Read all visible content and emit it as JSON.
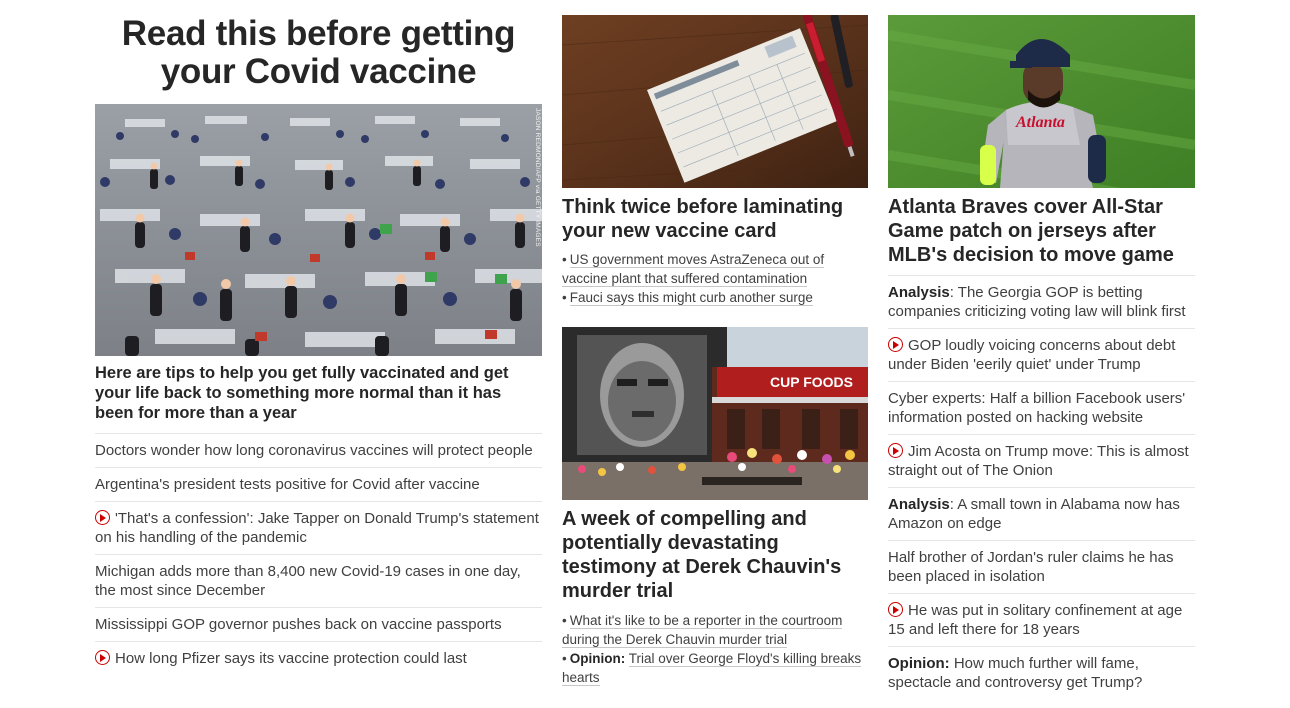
{
  "left": {
    "title": "Read this before getting your Covid vaccine",
    "photo_credit": "JASON REDMOND/AFP via GETTY IMAGES",
    "lead_headline": "Here are tips to help you get fully vaccinated and get your life back to something more normal than it has been for more than a year",
    "items": [
      {
        "text": "Doctors wonder how long coronavirus vaccines will protect people",
        "video": false
      },
      {
        "text": "Argentina's president tests positive for Covid after vaccine",
        "video": false
      },
      {
        "text": "'That's a confession': Jake Tapper on Donald Trump's statement on his handling of the pandemic",
        "video": true
      },
      {
        "text": "Michigan adds more than 8,400 new Covid-19 cases in one day, the most since December",
        "video": false
      },
      {
        "text": "Mississippi GOP governor pushes back on vaccine passports",
        "video": false
      },
      {
        "text": "How long Pfizer says its vaccine protection could last",
        "video": true
      }
    ]
  },
  "middle": {
    "story1": {
      "headline": "Think twice before laminating your new vaccine card",
      "bullets": [
        "US government moves AstraZeneca out of vaccine plant that suffered contamination",
        "Fauci says this might curb another surge"
      ]
    },
    "story2": {
      "headline": "A week of compelling and potentially devastating testimony at Derek Chauvin's murder trial",
      "bullet1": "What it's like to be a reporter in the courtroom during the Derek Chauvin murder trial",
      "bullet2_label": "Opinion:",
      "bullet2_text": "Trial over George Floyd's killing breaks hearts",
      "mural_sign": "CUP FOODS"
    }
  },
  "right": {
    "headline": "Atlanta Braves cover All-Star Game patch on jerseys after MLB's decision to move game",
    "jersey_text": "Atlanta",
    "items": [
      {
        "label": "Analysis",
        "sep": ": ",
        "text": "The Georgia GOP is betting companies criticizing voting law will blink first",
        "video": false
      },
      {
        "label": "",
        "sep": "",
        "text": "GOP loudly voicing concerns about debt under Biden 'eerily quiet' under Trump",
        "video": true
      },
      {
        "label": "",
        "sep": "",
        "text": "Cyber experts: Half a billion Facebook users' information posted on hacking website",
        "video": false
      },
      {
        "label": "",
        "sep": "",
        "text": "Jim Acosta on Trump move: This is almost straight out of The Onion",
        "video": true
      },
      {
        "label": "Analysis",
        "sep": ": ",
        "text": "A small town in Alabama now has Amazon on edge",
        "video": false
      },
      {
        "label": "",
        "sep": "",
        "text": "Half brother of Jordan's ruler claims he has been placed in isolation",
        "video": false
      },
      {
        "label": "",
        "sep": "",
        "text": "He was put in solitary confinement at age 15 and left there for 18 years",
        "video": true
      },
      {
        "label": "Opinion:",
        "sep": " ",
        "text": "How much further will fame, spectacle and controversy get Trump?",
        "video": false
      }
    ]
  },
  "colors": {
    "accent_red": "#cc0000",
    "text": "#262626"
  }
}
